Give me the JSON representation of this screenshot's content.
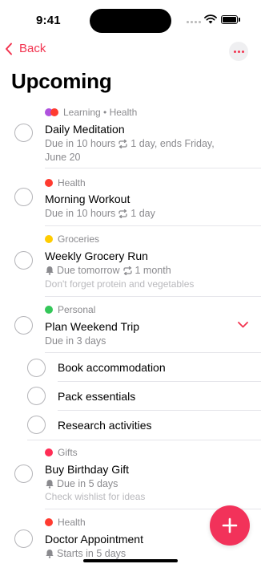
{
  "status": {
    "time": "9:41"
  },
  "nav": {
    "back_label": "Back"
  },
  "page": {
    "title": "Upcoming"
  },
  "reminders": [
    {
      "tags": "Learning • Health",
      "title": "Daily Meditation",
      "due": "Due in 10 hours",
      "repeat": "1 day, ends Friday, June 20",
      "colors": [
        "#af52de",
        "#ff3b30"
      ]
    },
    {
      "tags": "Health",
      "title": "Morning Workout",
      "due": "Due in 10 hours",
      "repeat": "1 day",
      "colors": [
        "#ff3b30"
      ]
    },
    {
      "tags": "Groceries",
      "title": "Weekly Grocery Run",
      "due": "Due tomorrow",
      "repeat": "1 month",
      "note": "Don't forget protein and vegetables",
      "colors": [
        "#ffcc00"
      ]
    },
    {
      "tags": "Personal",
      "title": "Plan Weekend Trip",
      "due": "Due in 3 days",
      "colors": [
        "#34c759"
      ],
      "expanded": true,
      "subtasks": [
        "Book accommodation",
        "Pack essentials",
        "Research activities"
      ]
    },
    {
      "tags": "Gifts",
      "title": "Buy Birthday Gift",
      "due": "Due in 5 days",
      "note": "Check wishlist for ideas",
      "colors": [
        "#ff2d55"
      ]
    },
    {
      "tags": "Health",
      "title": "Doctor Appointment",
      "due": "Starts in 5 days",
      "colors": [
        "#ff3b30"
      ]
    }
  ],
  "accent_color": "#f2334f"
}
